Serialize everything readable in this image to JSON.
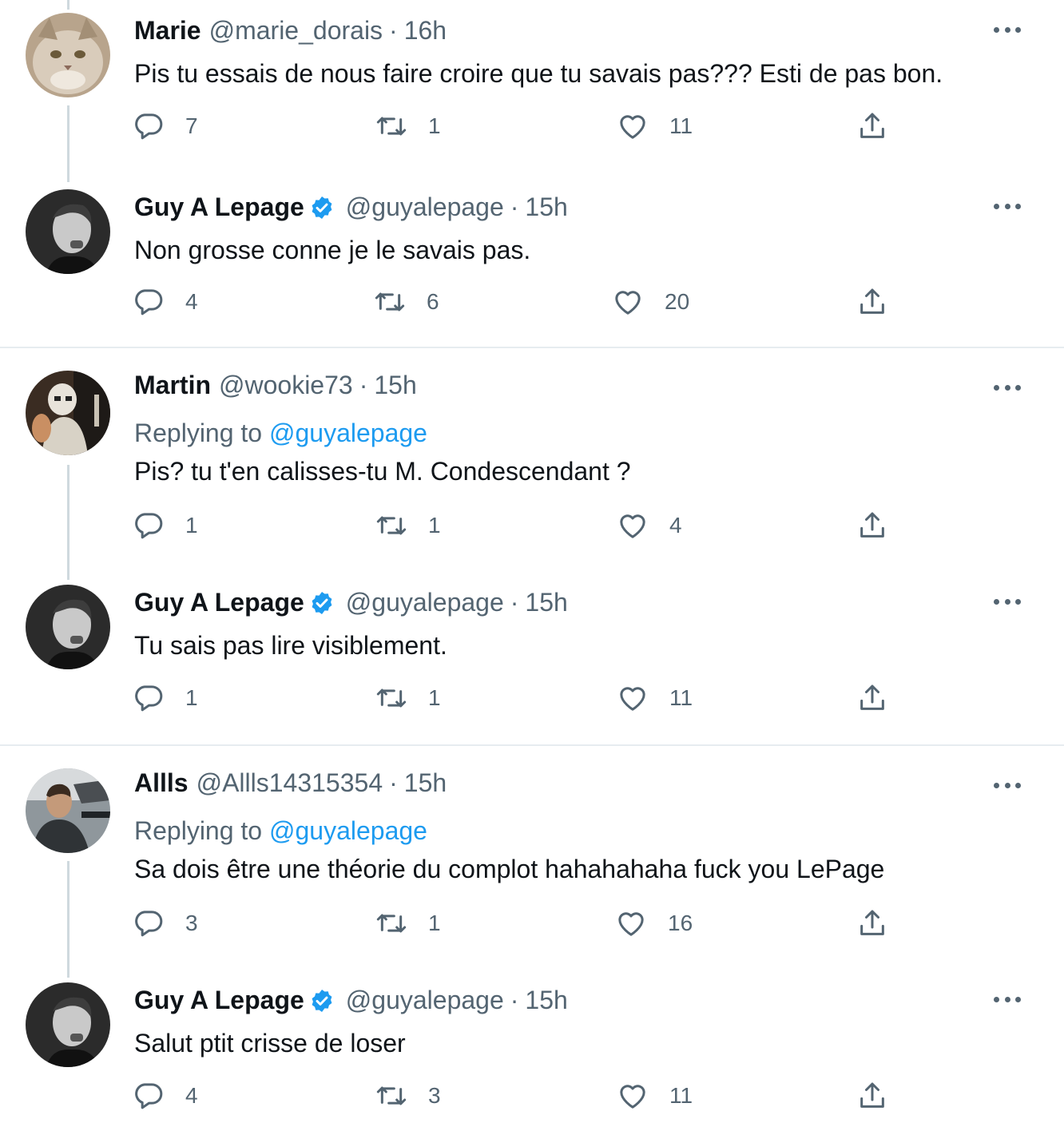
{
  "tweets": [
    {
      "name": "Marie",
      "handle": "@marie_dorais",
      "separator": "·",
      "time": "16h",
      "verified": false,
      "replying_label": "",
      "replying_mention": "",
      "text": "Pis tu essais de nous faire croire que tu savais pas??? Esti de pas bon.",
      "replies": "7",
      "retweets": "1",
      "likes": "11",
      "avatar": "cat-avatar"
    },
    {
      "name": "Guy A Lepage",
      "handle": "@guyalepage",
      "separator": "·",
      "time": "15h",
      "verified": true,
      "replying_label": "",
      "replying_mention": "",
      "text": "Non grosse conne je le savais pas.",
      "replies": "4",
      "retweets": "6",
      "likes": "20",
      "avatar": "man-bw-avatar"
    },
    {
      "name": "Martin",
      "handle": "@wookie73",
      "separator": "·",
      "time": "15h",
      "verified": false,
      "replying_label": "Replying to",
      "replying_mention": "@guyalepage",
      "text": "Pis? tu t'en calisses-tu M. Condescendant ?",
      "replies": "1",
      "retweets": "1",
      "likes": "4",
      "avatar": "stormtrooper-avatar"
    },
    {
      "name": "Guy A Lepage",
      "handle": "@guyalepage",
      "separator": "·",
      "time": "15h",
      "verified": true,
      "replying_label": "",
      "replying_mention": "",
      "text": "Tu sais pas lire visiblement.",
      "replies": "1",
      "retweets": "1",
      "likes": "11",
      "avatar": "man-bw-avatar"
    },
    {
      "name": "Allls",
      "handle": "@Allls14315354",
      "separator": "·",
      "time": "15h",
      "verified": false,
      "replying_label": "Replying to",
      "replying_mention": "@guyalepage",
      "text": "Sa dois être une théorie du complot hahahahaha fuck you LePage",
      "replies": "3",
      "retweets": "1",
      "likes": "16",
      "avatar": "driver-avatar"
    },
    {
      "name": "Guy A Lepage",
      "handle": "@guyalepage",
      "separator": "·",
      "time": "15h",
      "verified": true,
      "replying_label": "",
      "replying_mention": "",
      "text": "Salut ptit crisse de loser",
      "replies": "4",
      "retweets": "3",
      "likes": "11",
      "avatar": "man-bw-avatar"
    }
  ],
  "icons": {
    "reply": "reply-icon",
    "retweet": "retweet-icon",
    "like": "like-icon",
    "share": "share-icon",
    "more": "more-icon",
    "verified": "verified-badge-icon"
  },
  "colors": {
    "name": "#0f1419",
    "secondary": "#536471",
    "link": "#1d9bf0",
    "verified": "#1d9bf0",
    "divider": "#e6ecf0",
    "thread_line": "#cfd9de"
  }
}
